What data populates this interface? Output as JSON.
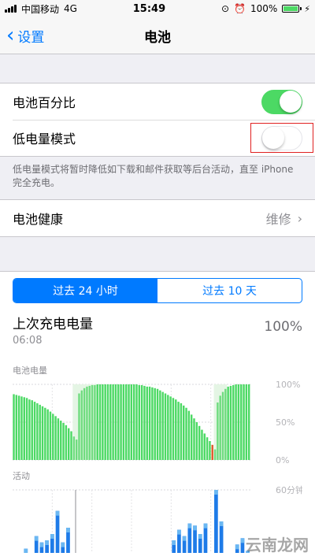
{
  "status": {
    "carrier": "中国移动",
    "network": "4G",
    "time": "15:49",
    "battery": "100%"
  },
  "nav": {
    "back": "设置",
    "title": "电池"
  },
  "settings": {
    "battery_percentage": {
      "label": "电池百分比",
      "on": true
    },
    "low_power": {
      "label": "低电量模式",
      "on": false
    },
    "note": "低电量模式将暂时降低如下载和邮件获取等后台活动，直至 iPhone 完全充电。"
  },
  "health": {
    "label": "电池健康",
    "value": "维修"
  },
  "usage": {
    "tabs": [
      "过去 24 小时",
      "过去 10 天"
    ],
    "active_tab": 0,
    "last_charge": {
      "title": "上次充电电量",
      "time": "06:08",
      "value": "100%"
    },
    "battery_chart_title": "电池电量",
    "battery_axis": [
      "100%",
      "50%",
      "0%"
    ],
    "activity_title": "活动",
    "activity_axis": [
      "60分钟"
    ]
  },
  "colors": {
    "accent": "#007aff",
    "green": "#4cd964",
    "red": "#e02020"
  },
  "watermark": "云南龙网",
  "chart_data": [
    {
      "type": "bar",
      "title": "电池电量",
      "ylim": [
        0,
        100
      ],
      "values": [
        87,
        86,
        85,
        84,
        83,
        82,
        80,
        79,
        77,
        75,
        73,
        71,
        69,
        67,
        64,
        61,
        58,
        55,
        52,
        49,
        46,
        42,
        38,
        31,
        27,
        88,
        92,
        95,
        97,
        98,
        99,
        99,
        100,
        100,
        100,
        100,
        100,
        100,
        100,
        100,
        100,
        100,
        100,
        100,
        100,
        100,
        100,
        100,
        99,
        99,
        98,
        97,
        97,
        96,
        95,
        94,
        92,
        90,
        88,
        86,
        84,
        82,
        80,
        77,
        75,
        72,
        69,
        65,
        60,
        55,
        50,
        45,
        40,
        35,
        30,
        25,
        20,
        14,
        76,
        85,
        90,
        94,
        97,
        98,
        99,
        100,
        100,
        100,
        100,
        100,
        100
      ],
      "charging_ranges": [
        [
          23,
          31
        ],
        [
          77,
          81
        ]
      ],
      "low_index": 76
    },
    {
      "type": "bar",
      "title": "活动",
      "ylim": [
        0,
        60
      ],
      "values": [
        0,
        0,
        4,
        0,
        16,
        10,
        12,
        18,
        40,
        10,
        24,
        0,
        0,
        0,
        0,
        0,
        0,
        0,
        0,
        0,
        0,
        0,
        0,
        0,
        0,
        0,
        0,
        0,
        0,
        0,
        12,
        22,
        16,
        28,
        26,
        18,
        28,
        0,
        62,
        30,
        0,
        0,
        8,
        14,
        2
      ]
    }
  ]
}
